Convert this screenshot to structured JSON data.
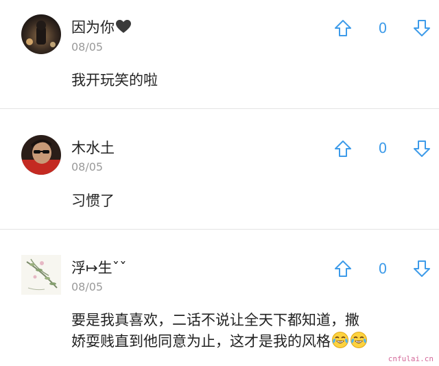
{
  "comments": [
    {
      "username": "因为你",
      "date": "08/05",
      "text": "我开玩笑的啦",
      "votes": "0",
      "name_icon": "black-heart-icon"
    },
    {
      "username": "木水土",
      "date": "08/05",
      "text": "习惯了",
      "votes": "0"
    },
    {
      "username": "浮↦生ˇˇ",
      "date": "08/05",
      "text_line1": "要是我真喜欢，二话不说让全天下都知道，撒",
      "text_line2": "娇耍贱直到他同意为止，这才是我的风格",
      "votes": "0",
      "trailing_icons": [
        "tears-of-joy-emoji-icon",
        "tears-of-joy-emoji-icon"
      ]
    }
  ],
  "watermark": "cnfulai.cn",
  "colors": {
    "accent": "#3d9be9",
    "date": "#9a9a9a",
    "divider": "#e3e3e3"
  }
}
